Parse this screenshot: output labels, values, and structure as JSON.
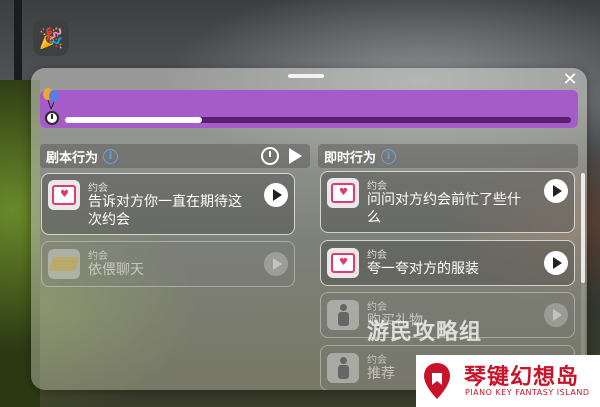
{
  "progress": {
    "value": 0.27
  },
  "colors": {
    "progress_box": "#a65cc8",
    "progress_track": "#5a1f72",
    "accent_pink": "#e03b70",
    "brand_red": "#c8142a"
  },
  "left_section": {
    "title": "剧本行为",
    "cards": [
      {
        "category": "约会",
        "title_line1": "告诉对方你一直在期待这",
        "title_line2": "次约会",
        "icon": "calendar-heart-icon",
        "enabled": true
      },
      {
        "category": "约会",
        "title_line1": "依偎聊天",
        "title_line2": "",
        "icon": "rug-icon",
        "enabled": false
      }
    ]
  },
  "right_section": {
    "title": "即时行为",
    "cards": [
      {
        "category": "约会",
        "title_line1": "问问对方约会前忙了些什",
        "title_line2": "么",
        "icon": "calendar-heart-icon",
        "enabled": true
      },
      {
        "category": "约会",
        "title_line1": "夸一夸对方的服装",
        "title_line2": "",
        "icon": "calendar-heart-icon",
        "enabled": true
      },
      {
        "category": "约会",
        "title_line1": "购买礼物",
        "title_line2": "",
        "icon": "person-icon",
        "enabled": false
      },
      {
        "category": "约会",
        "title_line1": "推荐",
        "title_line2": "",
        "icon": "person-icon",
        "enabled": false
      }
    ]
  },
  "watermark": {
    "text": "游民攻略组"
  },
  "logo": {
    "name": "琴键幻想岛",
    "sub": "PIANO KEY FANTASY ISLAND"
  }
}
